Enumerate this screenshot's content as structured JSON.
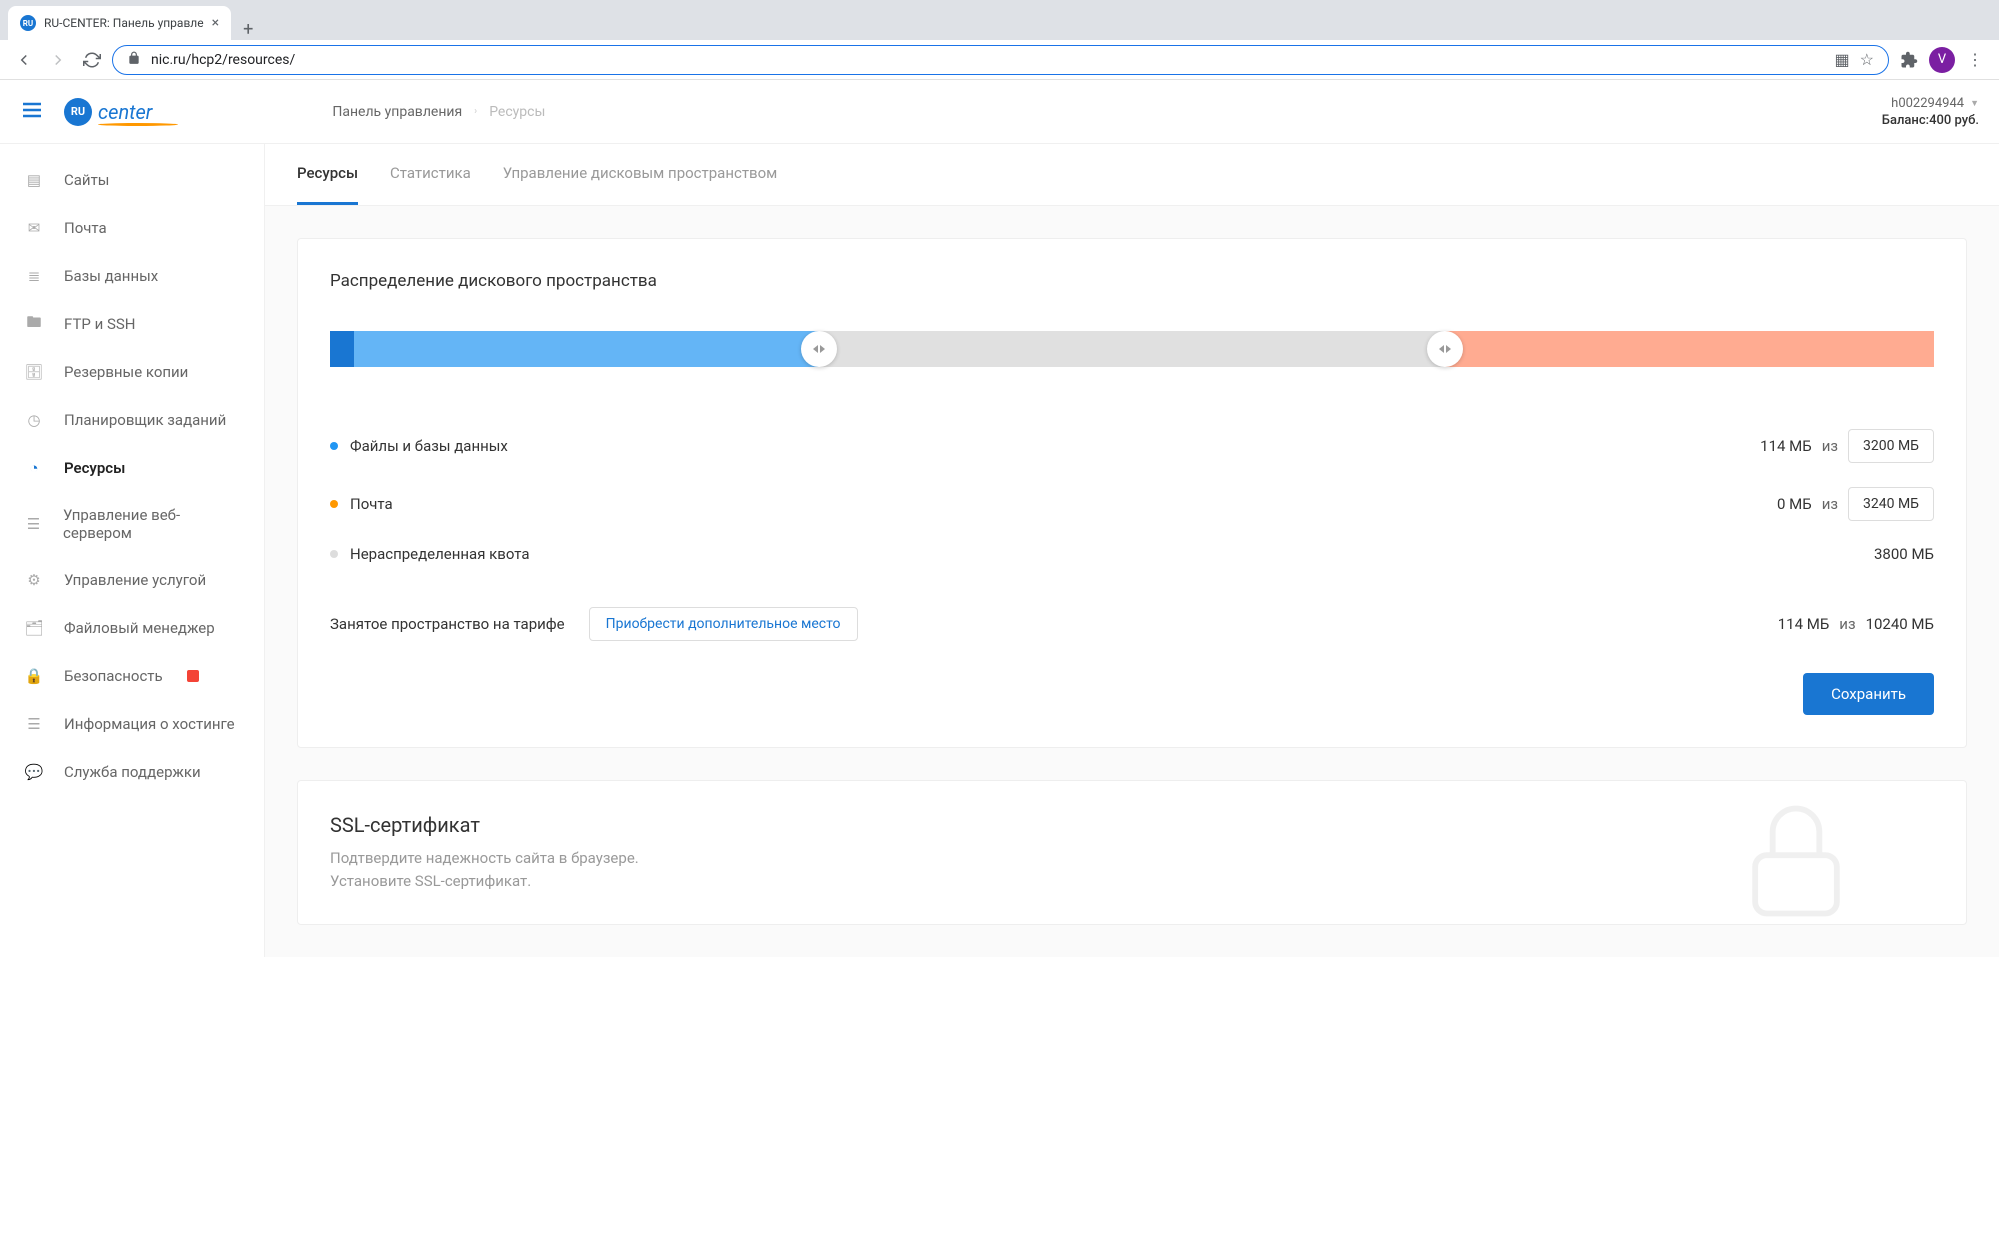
{
  "browser": {
    "tab_title": "RU-CENTER: Панель управле",
    "url": "nic.ru/hcp2/resources/",
    "avatar_letter": "V"
  },
  "header": {
    "logo_badge": "RU",
    "logo_text": "center",
    "breadcrumb": {
      "root": "Панель управления",
      "current": "Ресурсы"
    },
    "account_id": "h002294944",
    "balance_label": "Баланс:",
    "balance_value": "400 руб."
  },
  "sidebar": {
    "items": [
      {
        "label": "Сайты",
        "icon": "sites"
      },
      {
        "label": "Почта",
        "icon": "mail"
      },
      {
        "label": "Базы данных",
        "icon": "db"
      },
      {
        "label": "FTP и SSH",
        "icon": "folder"
      },
      {
        "label": "Резервные копии",
        "icon": "archive"
      },
      {
        "label": "Планировщик заданий",
        "icon": "clock"
      },
      {
        "label": "Ресурсы",
        "icon": "pie",
        "active": true
      },
      {
        "label": "Управление веб-сервером",
        "icon": "server"
      },
      {
        "label": "Управление услугой",
        "icon": "settings"
      },
      {
        "label": "Файловый менеджер",
        "icon": "filemgr"
      },
      {
        "label": "Безопасность",
        "icon": "lock",
        "badge": true
      },
      {
        "label": "Информация о хостинге",
        "icon": "info"
      },
      {
        "label": "Служба поддержки",
        "icon": "chat"
      }
    ]
  },
  "tabs": {
    "items": [
      {
        "label": "Ресурсы",
        "active": true
      },
      {
        "label": "Статистика"
      },
      {
        "label": "Управление дисковым пространством"
      }
    ]
  },
  "disk": {
    "title": "Распределение дискового пространства",
    "rows": {
      "files": {
        "label": "Файлы и базы данных",
        "used": "114 МБ",
        "of": "из",
        "quota": "3200 МБ"
      },
      "mail": {
        "label": "Почта",
        "used": "0 МБ",
        "of": "из",
        "quota": "3240 МБ"
      },
      "unalloc": {
        "label": "Нераспределенная квота",
        "value": "3800 МБ"
      }
    },
    "tariff": {
      "label": "Занятое пространство на тарифе",
      "buy": "Приобрести дополнительное место",
      "used": "114 МБ",
      "of": "из",
      "total": "10240 МБ"
    },
    "save": "Сохранить"
  },
  "ssl": {
    "title": "SSL-сертификат",
    "line1": "Подтвердите надежность сайта в браузере.",
    "line2": "Установите SSL-сертификат."
  }
}
